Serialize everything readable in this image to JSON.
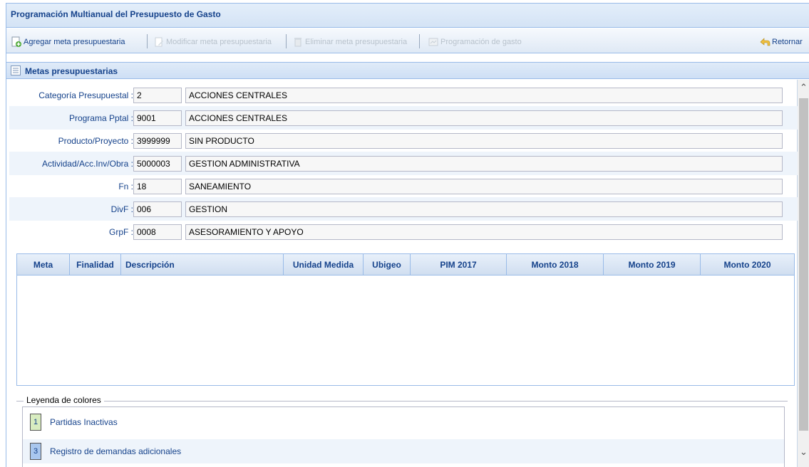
{
  "window": {
    "title": "Programación Multianual del Presupuesto de Gasto"
  },
  "toolbar": {
    "add_label": "Agregar meta presupuestaria",
    "modify_label": "Modificar meta presupuestaria",
    "delete_label": "Eliminar meta presupuestaria",
    "programming_label": "Programación de gasto",
    "return_label": "Retornar"
  },
  "panel": {
    "title": "Metas presupuestarias"
  },
  "form": {
    "rows": [
      {
        "label": "Categoría Presupuestal :",
        "code": "2",
        "description": "ACCIONES CENTRALES"
      },
      {
        "label": "Programa Pptal :",
        "code": "9001",
        "description": "ACCIONES CENTRALES"
      },
      {
        "label": "Producto/Proyecto :",
        "code": "3999999",
        "description": "SIN PRODUCTO"
      },
      {
        "label": "Actividad/Acc.Inv/Obra :",
        "code": "5000003",
        "description": "GESTION ADMINISTRATIVA"
      },
      {
        "label": "Fn :",
        "code": "18",
        "description": "SANEAMIENTO"
      },
      {
        "label": "DivF :",
        "code": "006",
        "description": "GESTION"
      },
      {
        "label": "GrpF :",
        "code": "0008",
        "description": "ASESORAMIENTO Y APOYO"
      }
    ]
  },
  "grid": {
    "columns": [
      "Meta",
      "Finalidad",
      "Descripción",
      "Unidad Medida",
      "Ubigeo",
      "PIM 2017",
      "Monto 2018",
      "Monto 2019",
      "Monto 2020"
    ],
    "rows": []
  },
  "legend": {
    "title": "Leyenda de colores",
    "items": [
      {
        "number": "1",
        "label": "Partidas Inactivas",
        "color": "#d8ecc0"
      },
      {
        "number": "3",
        "label": "Registro de demandas adicionales",
        "color": "#a9c7ee"
      }
    ]
  },
  "colors": {
    "header_text": "#15428b",
    "border": "#99bbe8"
  }
}
